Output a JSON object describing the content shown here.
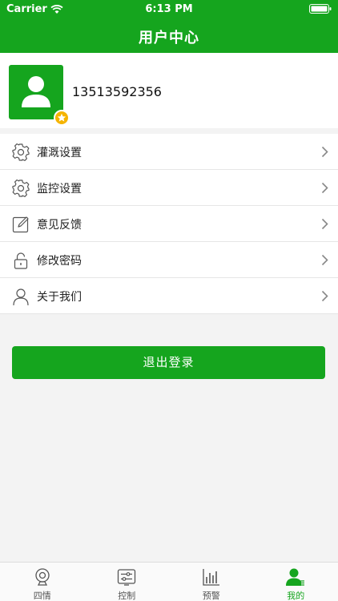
{
  "status_bar": {
    "carrier": "Carrier",
    "time": "6:13 PM"
  },
  "nav": {
    "title": "用户中心"
  },
  "profile": {
    "phone": "13513592356"
  },
  "menu": {
    "items": [
      {
        "label": "灌溉设置",
        "icon": "gear-icon"
      },
      {
        "label": "监控设置",
        "icon": "gear-icon"
      },
      {
        "label": "意见反馈",
        "icon": "edit-icon"
      },
      {
        "label": "修改密码",
        "icon": "lock-icon"
      },
      {
        "label": "关于我们",
        "icon": "person-icon"
      }
    ]
  },
  "logout": {
    "label": "退出登录"
  },
  "tabs": [
    {
      "label": "四情",
      "icon": "camera-icon",
      "active": false
    },
    {
      "label": "控制",
      "icon": "sliders-icon",
      "active": false
    },
    {
      "label": "预警",
      "icon": "bar-chart-icon",
      "active": false
    },
    {
      "label": "我的",
      "icon": "user-icon",
      "active": true
    }
  ],
  "colors": {
    "brand": "#15a51e",
    "badge": "#f5b400",
    "background": "#f3f3f3"
  }
}
